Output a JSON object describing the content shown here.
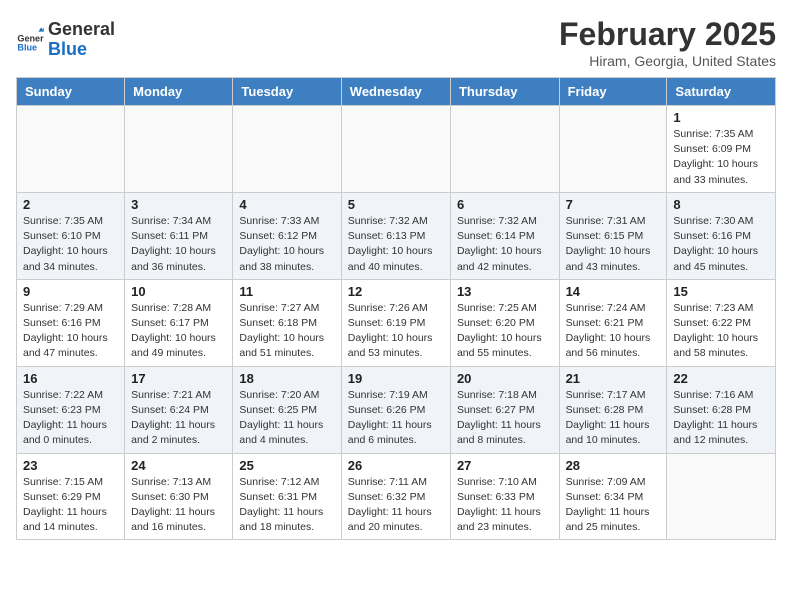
{
  "header": {
    "logo_line1": "General",
    "logo_line2": "Blue",
    "month_year": "February 2025",
    "location": "Hiram, Georgia, United States"
  },
  "days_of_week": [
    "Sunday",
    "Monday",
    "Tuesday",
    "Wednesday",
    "Thursday",
    "Friday",
    "Saturday"
  ],
  "weeks": [
    [
      {
        "day": "",
        "info": ""
      },
      {
        "day": "",
        "info": ""
      },
      {
        "day": "",
        "info": ""
      },
      {
        "day": "",
        "info": ""
      },
      {
        "day": "",
        "info": ""
      },
      {
        "day": "",
        "info": ""
      },
      {
        "day": "1",
        "info": "Sunrise: 7:35 AM\nSunset: 6:09 PM\nDaylight: 10 hours and 33 minutes."
      }
    ],
    [
      {
        "day": "2",
        "info": "Sunrise: 7:35 AM\nSunset: 6:10 PM\nDaylight: 10 hours and 34 minutes."
      },
      {
        "day": "3",
        "info": "Sunrise: 7:34 AM\nSunset: 6:11 PM\nDaylight: 10 hours and 36 minutes."
      },
      {
        "day": "4",
        "info": "Sunrise: 7:33 AM\nSunset: 6:12 PM\nDaylight: 10 hours and 38 minutes."
      },
      {
        "day": "5",
        "info": "Sunrise: 7:32 AM\nSunset: 6:13 PM\nDaylight: 10 hours and 40 minutes."
      },
      {
        "day": "6",
        "info": "Sunrise: 7:32 AM\nSunset: 6:14 PM\nDaylight: 10 hours and 42 minutes."
      },
      {
        "day": "7",
        "info": "Sunrise: 7:31 AM\nSunset: 6:15 PM\nDaylight: 10 hours and 43 minutes."
      },
      {
        "day": "8",
        "info": "Sunrise: 7:30 AM\nSunset: 6:16 PM\nDaylight: 10 hours and 45 minutes."
      }
    ],
    [
      {
        "day": "9",
        "info": "Sunrise: 7:29 AM\nSunset: 6:16 PM\nDaylight: 10 hours and 47 minutes."
      },
      {
        "day": "10",
        "info": "Sunrise: 7:28 AM\nSunset: 6:17 PM\nDaylight: 10 hours and 49 minutes."
      },
      {
        "day": "11",
        "info": "Sunrise: 7:27 AM\nSunset: 6:18 PM\nDaylight: 10 hours and 51 minutes."
      },
      {
        "day": "12",
        "info": "Sunrise: 7:26 AM\nSunset: 6:19 PM\nDaylight: 10 hours and 53 minutes."
      },
      {
        "day": "13",
        "info": "Sunrise: 7:25 AM\nSunset: 6:20 PM\nDaylight: 10 hours and 55 minutes."
      },
      {
        "day": "14",
        "info": "Sunrise: 7:24 AM\nSunset: 6:21 PM\nDaylight: 10 hours and 56 minutes."
      },
      {
        "day": "15",
        "info": "Sunrise: 7:23 AM\nSunset: 6:22 PM\nDaylight: 10 hours and 58 minutes."
      }
    ],
    [
      {
        "day": "16",
        "info": "Sunrise: 7:22 AM\nSunset: 6:23 PM\nDaylight: 11 hours and 0 minutes."
      },
      {
        "day": "17",
        "info": "Sunrise: 7:21 AM\nSunset: 6:24 PM\nDaylight: 11 hours and 2 minutes."
      },
      {
        "day": "18",
        "info": "Sunrise: 7:20 AM\nSunset: 6:25 PM\nDaylight: 11 hours and 4 minutes."
      },
      {
        "day": "19",
        "info": "Sunrise: 7:19 AM\nSunset: 6:26 PM\nDaylight: 11 hours and 6 minutes."
      },
      {
        "day": "20",
        "info": "Sunrise: 7:18 AM\nSunset: 6:27 PM\nDaylight: 11 hours and 8 minutes."
      },
      {
        "day": "21",
        "info": "Sunrise: 7:17 AM\nSunset: 6:28 PM\nDaylight: 11 hours and 10 minutes."
      },
      {
        "day": "22",
        "info": "Sunrise: 7:16 AM\nSunset: 6:28 PM\nDaylight: 11 hours and 12 minutes."
      }
    ],
    [
      {
        "day": "23",
        "info": "Sunrise: 7:15 AM\nSunset: 6:29 PM\nDaylight: 11 hours and 14 minutes."
      },
      {
        "day": "24",
        "info": "Sunrise: 7:13 AM\nSunset: 6:30 PM\nDaylight: 11 hours and 16 minutes."
      },
      {
        "day": "25",
        "info": "Sunrise: 7:12 AM\nSunset: 6:31 PM\nDaylight: 11 hours and 18 minutes."
      },
      {
        "day": "26",
        "info": "Sunrise: 7:11 AM\nSunset: 6:32 PM\nDaylight: 11 hours and 20 minutes."
      },
      {
        "day": "27",
        "info": "Sunrise: 7:10 AM\nSunset: 6:33 PM\nDaylight: 11 hours and 23 minutes."
      },
      {
        "day": "28",
        "info": "Sunrise: 7:09 AM\nSunset: 6:34 PM\nDaylight: 11 hours and 25 minutes."
      },
      {
        "day": "",
        "info": ""
      }
    ]
  ]
}
